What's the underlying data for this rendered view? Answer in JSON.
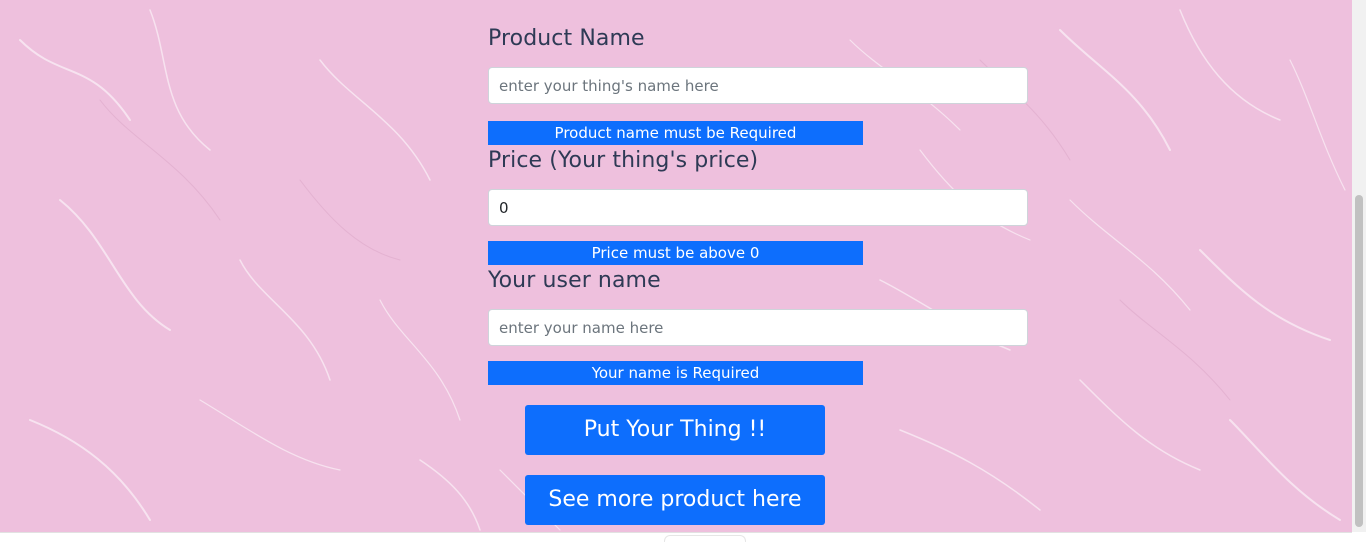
{
  "theme": {
    "background": "#eec0dd",
    "accent": "#0d6efd",
    "label_color": "#2e3a55"
  },
  "form": {
    "product_name": {
      "label": "Product Name",
      "placeholder": "enter your thing's name here",
      "value": "",
      "error": "Product name must be Required"
    },
    "price": {
      "label": "Price (Your thing's price)",
      "placeholder": "",
      "value": "0",
      "error": "Price must be above 0"
    },
    "user_name": {
      "label": "Your user name",
      "placeholder": "enter your name here",
      "value": "",
      "error": "Your name is Required"
    }
  },
  "buttons": {
    "submit_label": "Put Your Thing !!",
    "see_more_label": "See more product here"
  }
}
